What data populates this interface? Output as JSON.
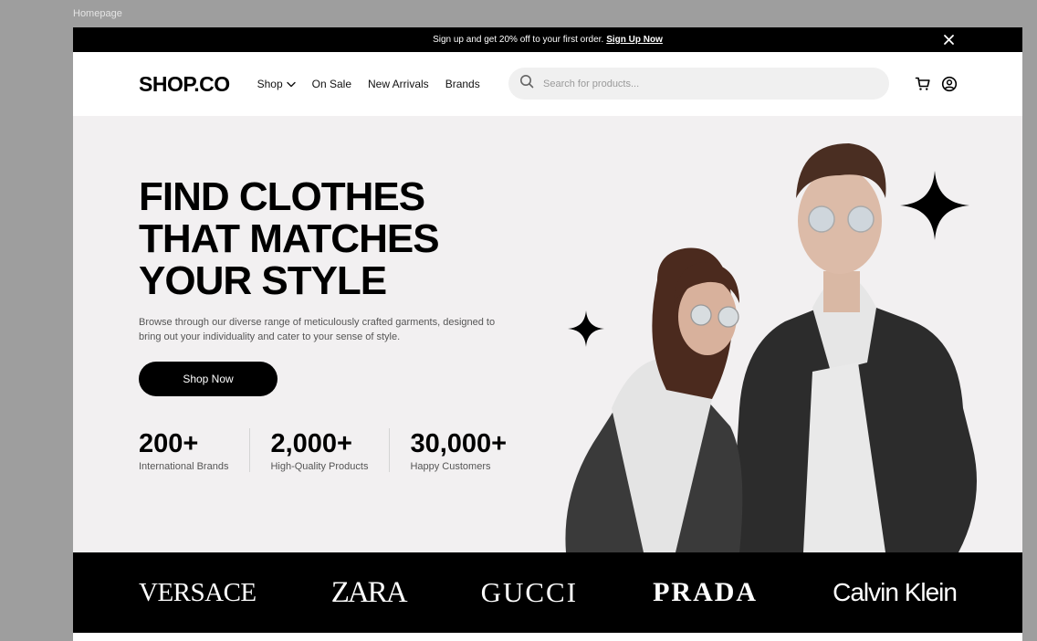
{
  "frame_label": "Homepage",
  "promo": {
    "text": "Sign up and get 20% off to your first order.",
    "link": "Sign Up Now",
    "close_icon": "close-icon"
  },
  "header": {
    "logo": "SHOP.CO",
    "nav": [
      {
        "label": "Shop",
        "has_dropdown": true
      },
      {
        "label": "On Sale"
      },
      {
        "label": "New Arrivals"
      },
      {
        "label": "Brands"
      }
    ],
    "search_placeholder": "Search for products...",
    "icons": [
      "search-icon",
      "cart-icon",
      "user-icon"
    ]
  },
  "hero": {
    "title_lines": [
      "FIND CLOTHES",
      "THAT MATCHES",
      "YOUR STYLE"
    ],
    "description": "Browse through our diverse range of meticulously crafted garments, designed to bring out your individuality and cater to your sense of style.",
    "cta": "Shop Now",
    "stats": [
      {
        "value": "200+",
        "label": "International Brands"
      },
      {
        "value": "2,000+",
        "label": "High-Quality Products"
      },
      {
        "value": "30,000+",
        "label": "Happy Customers"
      }
    ]
  },
  "brands": [
    "VERSACE",
    "ZARA",
    "GUCCI",
    "PRADA",
    "Calvin Klein"
  ],
  "colors": {
    "primary": "#000000",
    "hero_bg": "#f2f0f1",
    "search_bg": "#f0f0f0",
    "text_muted": "#555555"
  }
}
